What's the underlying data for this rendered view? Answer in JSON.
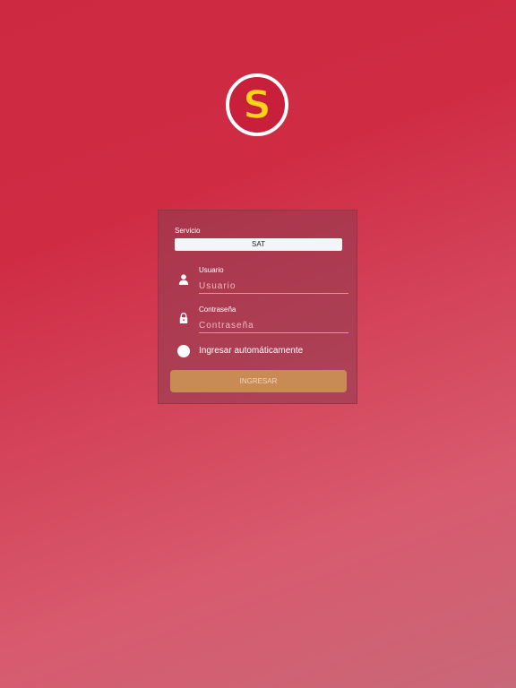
{
  "logo": {
    "letter": "S",
    "icon": "brand-s-logo-icon",
    "ring_color": "#ffffff",
    "letter_fill": "#ffd21a",
    "letter_outline": "#c81e3a"
  },
  "login": {
    "service_label": "Servicio",
    "service_value": "SAT",
    "username_label": "Usuario",
    "username_placeholder": "Usuario",
    "username_value": "",
    "username_icon": "user-icon",
    "password_label": "Contraseña",
    "password_placeholder": "Contraseña",
    "password_value": "",
    "password_icon": "lock-icon",
    "auto_login_label": "Ingresar automáticamente",
    "submit_label": "INGRESAR"
  },
  "colors": {
    "background": "#cd2a42",
    "accent_underline": "#e8a040",
    "submit_button": "#c98b55"
  }
}
